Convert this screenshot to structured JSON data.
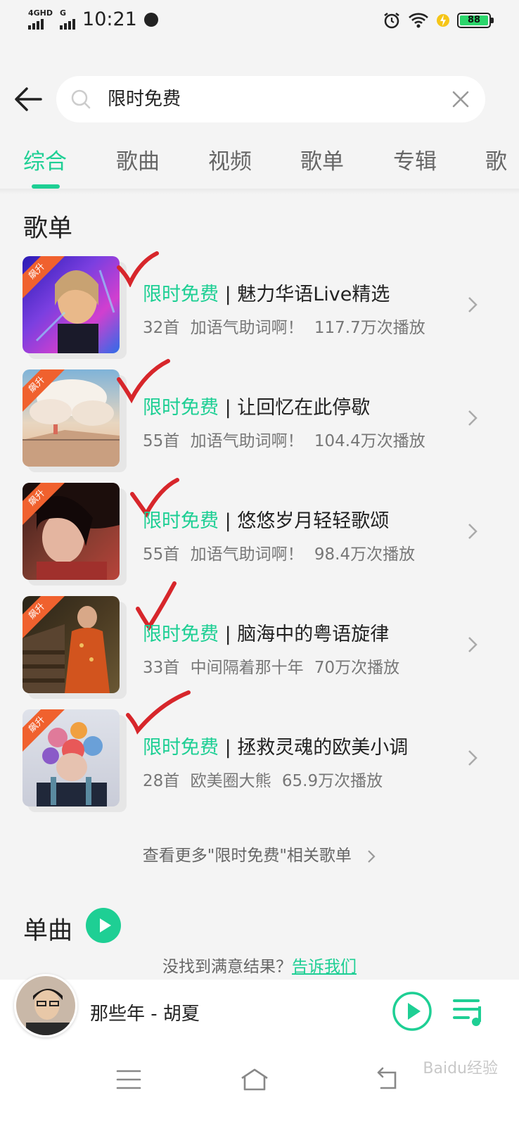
{
  "status_bar": {
    "network_1": "4GHD",
    "network_2": "G",
    "time": "10:21",
    "battery": "88"
  },
  "search": {
    "query": "限时免费"
  },
  "tabs": [
    {
      "label": "综合"
    },
    {
      "label": "歌曲"
    },
    {
      "label": "视频"
    },
    {
      "label": "歌单"
    },
    {
      "label": "专辑"
    },
    {
      "label": "歌"
    }
  ],
  "playlists_section": {
    "title": "歌单",
    "badge": "飙升",
    "items": [
      {
        "highlight": "限时免费",
        "separator": " | ",
        "title": "魅力华语Live精选",
        "meta": "32首  加语气助词啊！  117.7万次播放"
      },
      {
        "highlight": "限时免费",
        "separator": " | ",
        "title": "让回忆在此停歇",
        "meta": "55首  加语气助词啊！  104.4万次播放"
      },
      {
        "highlight": "限时免费",
        "separator": " | ",
        "title": "悠悠岁月轻轻歌颂",
        "meta": "55首  加语气助词啊！  98.4万次播放"
      },
      {
        "highlight": "限时免费",
        "separator": "  |  ",
        "title": "脑海中的粤语旋律",
        "meta": "33首  中间隔着那十年  70万次播放"
      },
      {
        "highlight": "限时免费",
        "separator": " | ",
        "title": "拯救灵魂的欧美小调",
        "meta": "28首  欧美圈大熊  65.9万次播放"
      }
    ],
    "more_link": "查看更多\"限时免费\"相关歌单"
  },
  "singles_section": {
    "title": "单曲"
  },
  "feedback": {
    "prompt": "没找到满意结果？",
    "link": "告诉我们"
  },
  "player": {
    "now_playing": "那些年 - 胡夏"
  },
  "watermark": "Baidu经验",
  "colors": {
    "accent": "#1ecf94",
    "badge": "#f0612e",
    "annotation": "#d7262b"
  }
}
